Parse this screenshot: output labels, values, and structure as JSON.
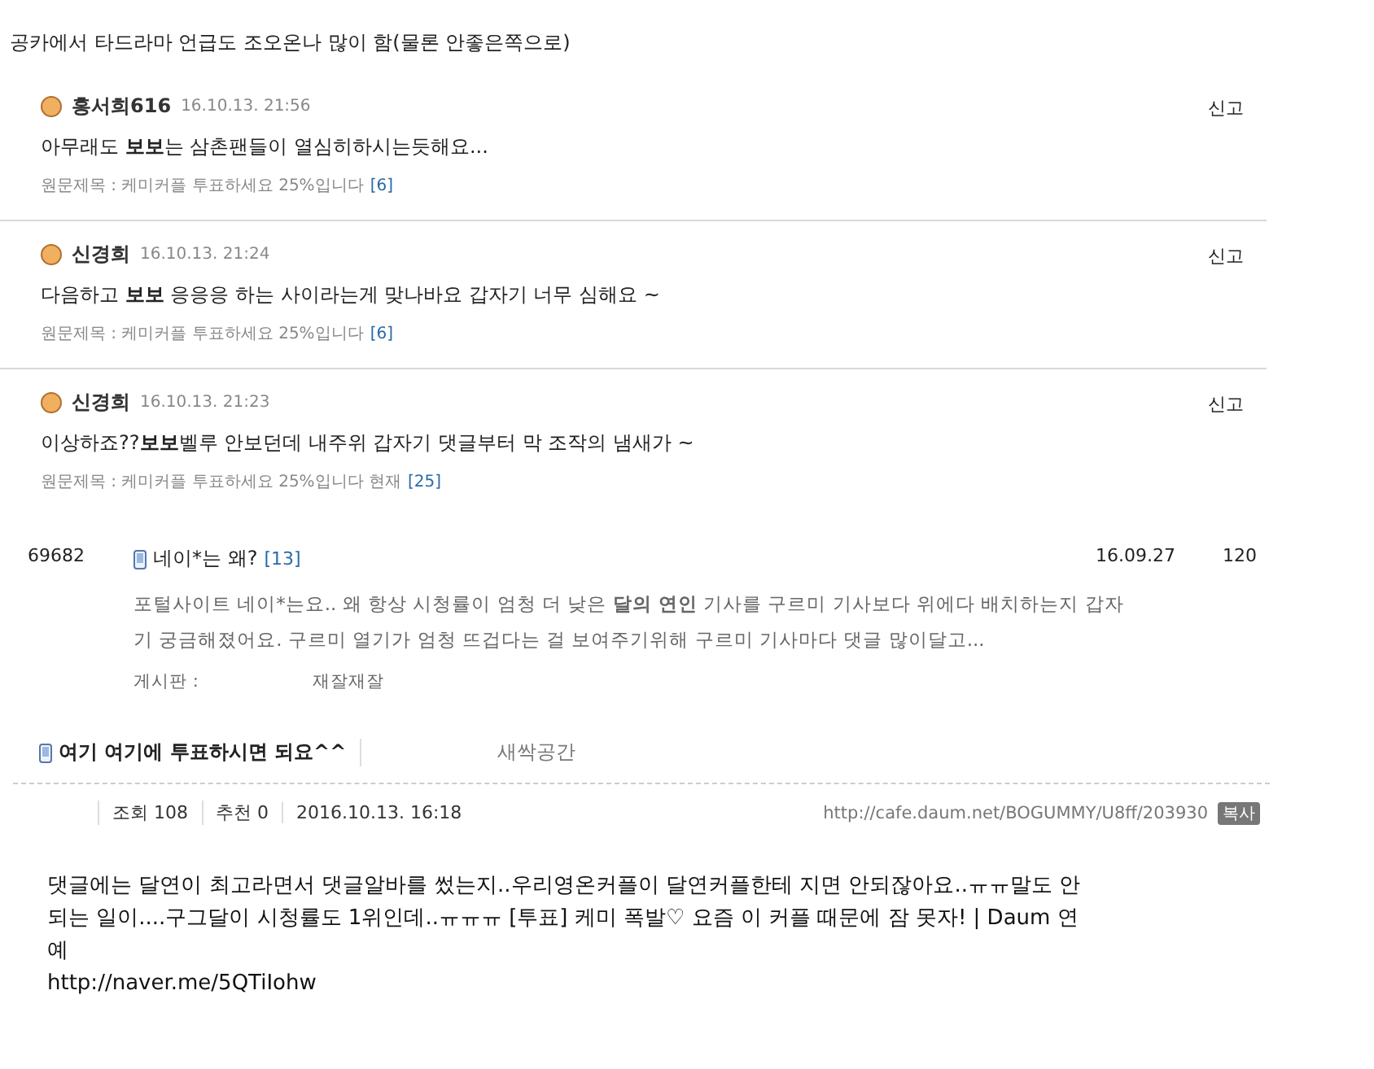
{
  "headline": "공카에서 타드라마 언급도 조오온나 많이 함(물론 안좋은쪽으로)",
  "comments": [
    {
      "author": "홍서희616",
      "time": "16.10.13. 21:56",
      "body": "아무래도 **보보**는 삼촌팬들이 열심히하시는듯해요...",
      "source": "원문제목 : 케미커플 투표하세요 25%입니다",
      "source_count": "[6]",
      "report": "신고"
    },
    {
      "author": "신경희",
      "time": "16.10.13. 21:24",
      "body": "다음하고 **보보** 응응응 하는 사이라는게 맞나바요 갑자기 너무 심해요 ~",
      "source": "원문제목 : 케미커플 투표하세요 25%입니다",
      "source_count": "[6]",
      "report": "신고"
    },
    {
      "author": "신경희",
      "time": "16.10.13. 21:23",
      "body": "이상하죠??**보보**벨루 안보던데 내주위 갑자기 댓글부터 막 조작의 냄새가 ~",
      "source": "원문제목 : 케미커플 투표하세요 25%입니다 현재",
      "source_count": "[25]",
      "report": "신고"
    }
  ],
  "post": {
    "number": "69682",
    "title": "네이*는 왜?",
    "count": "[13]",
    "date": "16.09.27",
    "views": "120",
    "excerpt": "포털사이트 네이*는요.. 왜 항상 시청률이 엄청 더 낮은 **달의 연인** 기사를 구르미 기사보다 위에다 배치하는지 갑자기 궁금해졌어요. 구르미 열기가 엄청 뜨겁다는 걸 보여주기위해 구르미 기사마다 댓글 많이달고...",
    "board_label": "게시판 :",
    "board": "재잘재잘"
  },
  "article": {
    "title": "여기 여기에 투표하시면 되요^^",
    "category": "새싹공간",
    "views": "조회 108",
    "likes": "추천 0",
    "datetime": "2016.10.13. 16:18",
    "url": "http://cafe.daum.net/BOGUMMY/U8ff/203930",
    "copy": "복사"
  },
  "body": {
    "text": "댓글에는 달연이 최고라면서 댓글알바를 썼는지..우리영온커플이 달연커플한테 지면 안되잖아요..ㅠㅠ말도 안되는 일이....구그달이 시청률도 1위인데..ㅠㅠㅠ [투표] 케미 폭발♡ 요즘 이 커플 때문에 잠 못자! | Daum 연예",
    "link": "http://naver.me/5QTiIohw"
  }
}
